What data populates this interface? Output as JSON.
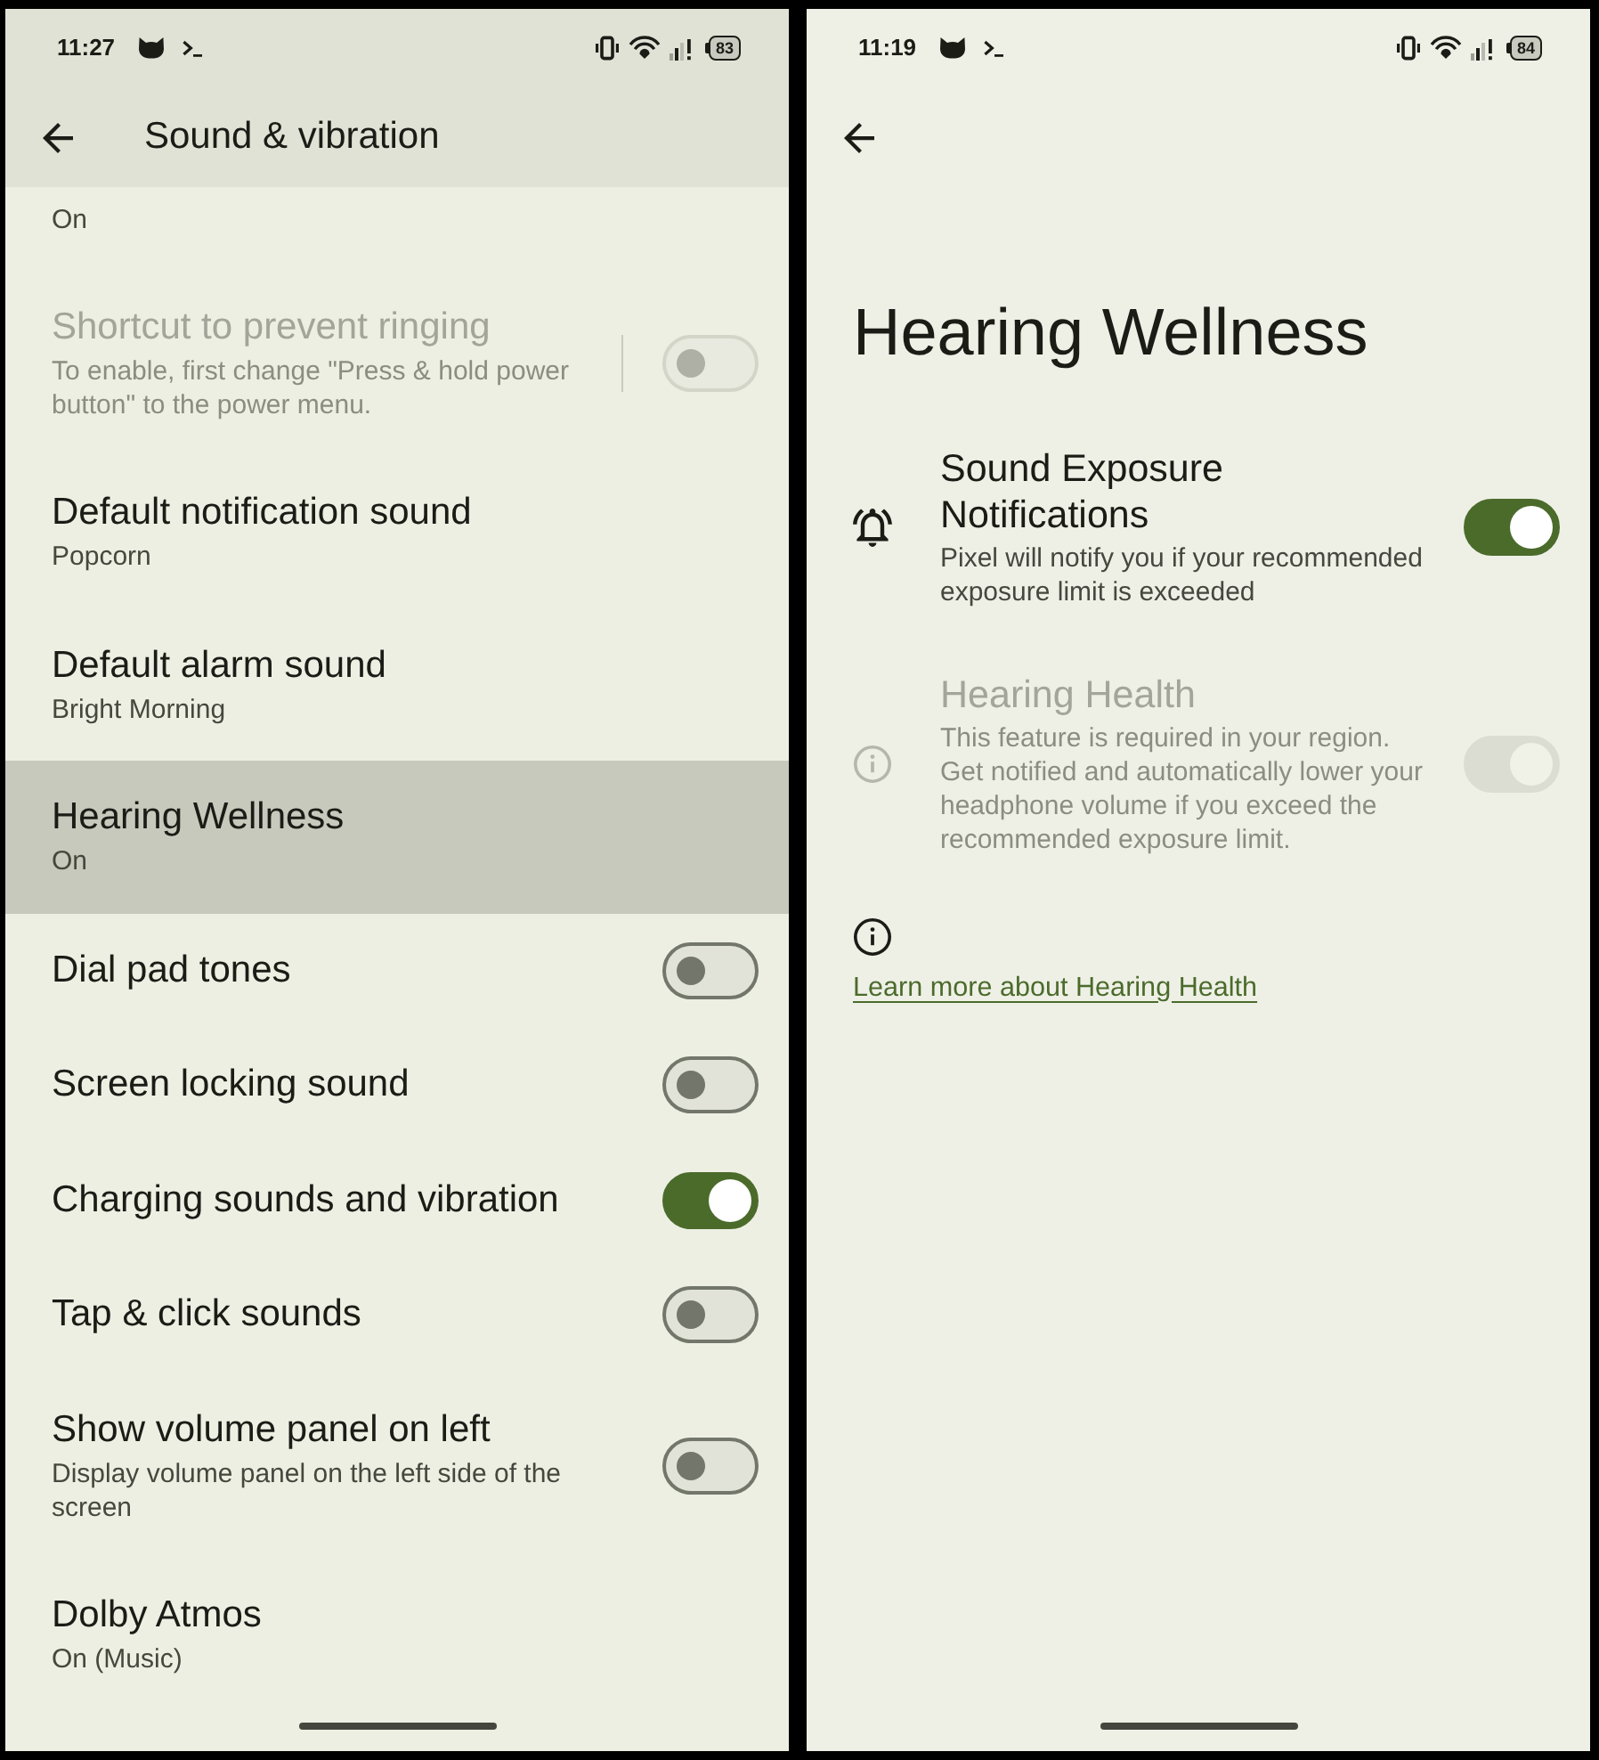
{
  "screens": [
    {
      "status_bar": {
        "time": "11:27",
        "battery": "83"
      },
      "app_bar": {
        "title": "Sound & vibration",
        "scrolled": true
      },
      "items": [
        {
          "kind": "summary_only",
          "summary": "On",
          "selected": false,
          "disabled": false
        },
        {
          "kind": "split_toggle",
          "title": "Shortcut to prevent ringing",
          "summary": "To enable, first change \"Press & hold power button\" to the power menu.",
          "checked": false,
          "selected": false,
          "disabled": true
        },
        {
          "kind": "link",
          "title": "Default notification sound",
          "summary": "Popcorn",
          "selected": false,
          "disabled": false
        },
        {
          "kind": "link",
          "title": "Default alarm sound",
          "summary": "Bright Morning",
          "selected": false,
          "disabled": false
        },
        {
          "kind": "link",
          "title": "Hearing Wellness",
          "summary": "On",
          "selected": true,
          "disabled": false
        },
        {
          "kind": "toggle",
          "title": "Dial pad tones",
          "checked": false,
          "selected": false,
          "disabled": false
        },
        {
          "kind": "toggle",
          "title": "Screen locking sound",
          "checked": false,
          "selected": false,
          "disabled": false
        },
        {
          "kind": "toggle",
          "title": "Charging sounds and vibration",
          "checked": true,
          "selected": false,
          "disabled": false
        },
        {
          "kind": "toggle",
          "title": "Tap & click sounds",
          "checked": false,
          "selected": false,
          "disabled": false
        },
        {
          "kind": "toggle",
          "title": "Show volume panel on left",
          "summary": "Display volume panel on the left side of the screen",
          "checked": false,
          "selected": false,
          "disabled": false
        },
        {
          "kind": "link",
          "title": "Dolby Atmos",
          "summary": "On (Music)",
          "selected": false,
          "disabled": false
        }
      ]
    },
    {
      "status_bar": {
        "time": "11:19",
        "battery": "84"
      },
      "app_bar": {
        "scrolled": false
      },
      "page_title": "Hearing Wellness",
      "items": [
        {
          "kind": "icon_toggle",
          "title": "Sound Exposure Notifications",
          "summary": "Pixel will notify you if your recommended exposure limit is exceeded",
          "checked": true,
          "disabled": false
        },
        {
          "kind": "icon_toggle",
          "title": "Hearing Health",
          "summary": "This feature is required in your region. Get notified and automatically lower your headphone volume if you exceed the recommended exposure limit.",
          "checked": true,
          "disabled": true
        }
      ],
      "footer": {
        "link": "Learn more about Hearing Health"
      }
    }
  ]
}
